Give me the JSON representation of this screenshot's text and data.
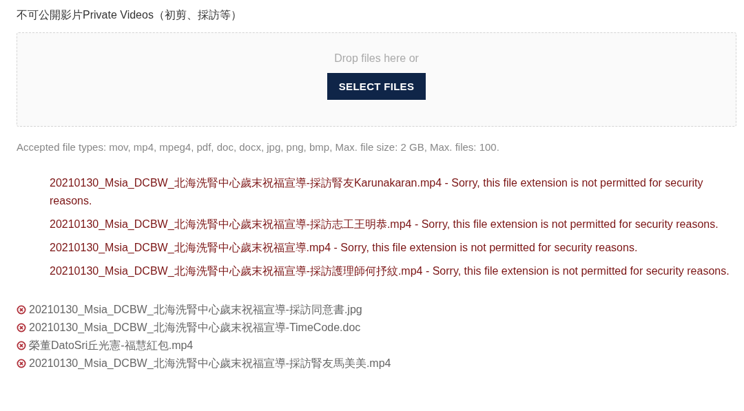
{
  "field_label": "不可公開影片Private Videos（初剪、採訪等）",
  "dropzone": {
    "hint": "Drop files here or",
    "button": "SELECT FILES"
  },
  "description": "Accepted file types: mov, mp4, mpeg4, pdf, doc, docx, jpg, png, bmp, Max. file size: 2 GB, Max. files: 100.",
  "errors": [
    "20210130_Msia_DCBW_北海洗腎中心歲末祝福宣導-採訪腎友Karunakaran.mp4 - Sorry, this file extension is not permitted for security reasons.",
    "20210130_Msia_DCBW_北海洗腎中心歲末祝福宣導-採訪志工王明恭.mp4 - Sorry, this file extension is not permitted for security reasons.",
    "20210130_Msia_DCBW_北海洗腎中心歲末祝福宣導.mp4 - Sorry, this file extension is not permitted for security reasons.",
    "20210130_Msia_DCBW_北海洗腎中心歲末祝福宣導-採訪護理師何抒紋.mp4 - Sorry, this file extension is not permitted for security reasons."
  ],
  "files": [
    {
      "name": "20210130_Msia_DCBW_北海洗腎中心歲末祝福宣導-採訪同意書.jpg"
    },
    {
      "name": "20210130_Msia_DCBW_北海洗腎中心歲末祝福宣導-TimeCode.doc"
    },
    {
      "name": "榮董DatoSri丘光憲-福慧紅包.mp4"
    },
    {
      "name": "20210130_Msia_DCBW_北海洗腎中心歲末祝福宣導-採訪腎友馬美美.mp4"
    }
  ]
}
